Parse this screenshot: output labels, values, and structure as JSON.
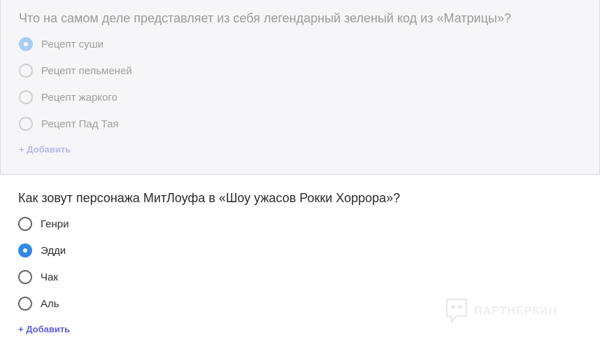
{
  "question1": {
    "title": "Что на самом деле представляет из себя легендарный зеленый код из «Матрицы»?",
    "options": [
      "Рецепт суши",
      "Рецепт пельменей",
      "Рецепт жаркого",
      "Рецепт Пад Тая"
    ],
    "selected": 0,
    "add_label": "+ Добавить"
  },
  "question2": {
    "title": "Как зовут персонажа МитЛоуфа в «Шоу ужасов Рокки Хоррора»?",
    "options": [
      "Генри",
      "Эдди",
      "Чак",
      "Аль"
    ],
    "selected": 1,
    "add_label": "+ Добавить"
  },
  "watermark": {
    "text": "ПАРТНЕРКИН"
  },
  "colors": {
    "accent": "#2f8ae6",
    "add_link": "#5b5fd1",
    "faded_panel": "#f6f6f9"
  }
}
